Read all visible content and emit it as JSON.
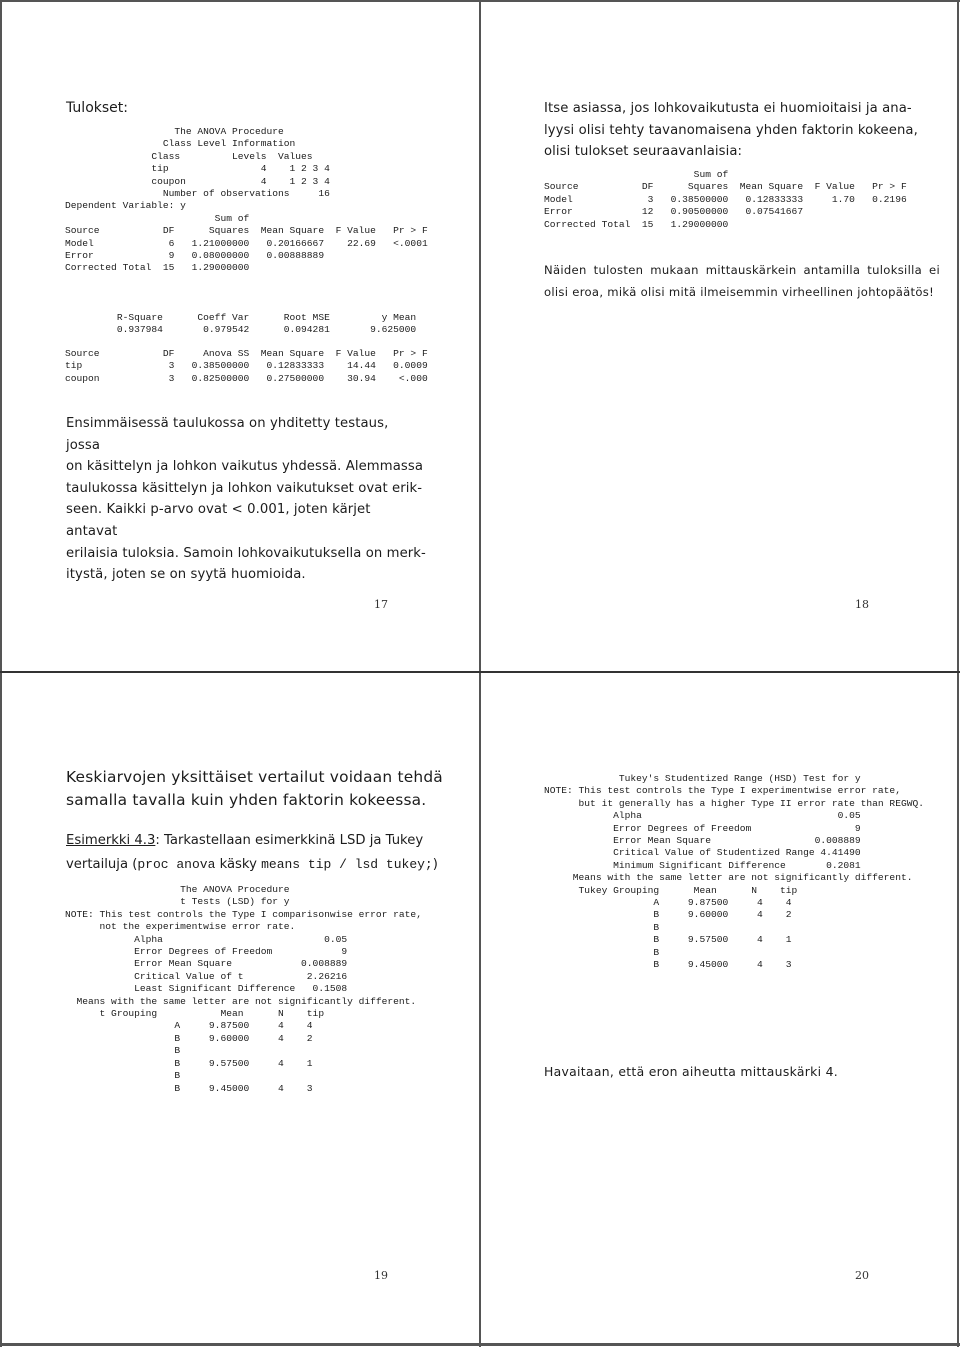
{
  "pages": [
    {
      "number": "17",
      "heading": "Tulokset:",
      "anova_title": "The ANOVA Procedure",
      "class_info": {
        "title": "Class Level Information",
        "headers": [
          "Class",
          "Levels",
          "Values"
        ],
        "rows": [
          [
            "tip",
            "4",
            "1 2 3 4"
          ],
          [
            "coupon",
            "4",
            "1 2 3 4"
          ]
        ],
        "observations_label": "Number of observations",
        "observations_value": "16"
      },
      "dependent_variable": "Dependent Variable: y",
      "model_table": {
        "headers": [
          "Source",
          "DF",
          "Sum of Squares",
          "Mean Square",
          "F Value",
          "Pr > F"
        ],
        "rows": [
          [
            "Model",
            "6",
            "1.21000000",
            "0.20166667",
            "22.69",
            "<.0001"
          ],
          [
            "Error",
            "9",
            "0.08000000",
            "0.00888889",
            "",
            ""
          ],
          [
            "Corrected Total",
            "15",
            "1.29000000",
            "",
            "",
            ""
          ]
        ]
      },
      "fit_stats": {
        "headers": [
          "R-Square",
          "Coeff Var",
          "Root MSE",
          "y Mean"
        ],
        "values": [
          "0.937984",
          "0.979542",
          "0.094281",
          "9.625000"
        ]
      },
      "effects_table": {
        "headers": [
          "Source",
          "DF",
          "Anova SS",
          "Mean Square",
          "F Value",
          "Pr > F"
        ],
        "rows": [
          [
            "tip",
            "3",
            "0.38500000",
            "0.12833333",
            "14.44",
            "0.0009"
          ],
          [
            "coupon",
            "3",
            "0.82500000",
            "0.27500000",
            "30.94",
            "<.000"
          ]
        ]
      },
      "paragraph": [
        "Ensimmäisessä taulukossa on yhditetty testaus, jossa",
        "on käsittelyn ja lohkon vaikutus yhdessä. Alemmassa",
        "taulukossa käsittelyn ja lohkon vaikutukset ovat erik-",
        "seen. Kaikki p-arvo ovat < 0.001, joten kärjet antavat",
        "erilaisia tuloksia. Samoin lohkovaikutuksella on merk-",
        "itystä, joten se on syytä huomioida."
      ]
    },
    {
      "number": "18",
      "paragraph": [
        "Itse asiassa, jos lohkovaikutusta ei huomioitaisi ja ana-",
        "lyysi olisi tehty tavanomaisena yhden faktorin kokeena,",
        "olisi tulokset seuraavanlaisia:"
      ],
      "oneway_table": {
        "headers": [
          "Source",
          "DF",
          "Sum of Squares",
          "Mean Square",
          "F Value",
          "Pr > F"
        ],
        "rows": [
          [
            "Model",
            "3",
            "0.38500000",
            "0.12833333",
            "1.70",
            "0.2196"
          ],
          [
            "Error",
            "12",
            "0.90500000",
            "0.07541667",
            "",
            ""
          ],
          [
            "Corrected Total",
            "15",
            "1.29000000",
            "",
            "",
            ""
          ]
        ]
      },
      "conclusion": [
        "Näiden tulosten mukaan mittauskärkein antamilla tuloksilla ei",
        "olisi eroa, mikä olisi mitä ilmeisemmin virheellinen johtopäätös!"
      ]
    },
    {
      "number": "19",
      "intro": [
        "Keskiarvojen yksittäiset vertailut voidaan tehdä",
        "samalla tavalla kuin yhden faktorin kokeessa."
      ],
      "example_label": "Esimerkki 4.3",
      "example_text_1": ":  Tarkastellaan esimerkkinä LSD ja Tukey",
      "example_text_2_pre": "vertailuja (",
      "example_code_1": "proc anova",
      "example_word": " käsky ",
      "example_code_2": "means tip / lsd tukey;",
      "example_text_2_post": ")",
      "lsd": {
        "title_1": "The ANOVA Procedure",
        "title_2": "t Tests (LSD) for y",
        "note_1": "NOTE: This test controls the Type I comparisonwise error rate,",
        "note_2": "not the experimentwise error rate.",
        "params": [
          [
            "Alpha",
            "0.05"
          ],
          [
            "Error Degrees of Freedom",
            "9"
          ],
          [
            "Error Mean Square",
            "0.008889"
          ],
          [
            "Critical Value of t",
            "2.26216"
          ],
          [
            "Least Significant Difference",
            "0.1508"
          ]
        ],
        "means_note": "Means with the same letter are not significantly different.",
        "grouping_headers": [
          "t Grouping",
          "Mean",
          "N",
          "tip"
        ],
        "grouping_rows": [
          [
            "A",
            "9.87500",
            "4",
            "4"
          ],
          [
            "",
            "",
            "",
            ""
          ],
          [
            "B",
            "9.60000",
            "4",
            "2"
          ],
          [
            "B",
            "",
            "",
            ""
          ],
          [
            "B",
            "9.57500",
            "4",
            "1"
          ],
          [
            "B",
            "",
            "",
            ""
          ],
          [
            "B",
            "9.45000",
            "4",
            "3"
          ]
        ]
      }
    },
    {
      "number": "20",
      "tukey": {
        "title": "Tukey's Studentized Range (HSD) Test for y",
        "note_1": "NOTE: This test controls the Type I experimentwise error rate,",
        "note_2": "but it generally has a higher Type II error rate than REGWQ.",
        "params": [
          [
            "Alpha",
            "0.05"
          ],
          [
            "Error Degrees of Freedom",
            "9"
          ],
          [
            "Error Mean Square",
            "0.008889"
          ],
          [
            "Critical Value of Studentized Range",
            "4.41490"
          ],
          [
            "Minimum Significant Difference",
            "0.2081"
          ]
        ],
        "means_note": "Means with the same letter are not significantly different.",
        "grouping_headers": [
          "Tukey Grouping",
          "Mean",
          "N",
          "tip"
        ],
        "grouping_rows": [
          [
            "A",
            "9.87500",
            "4",
            "4"
          ],
          [
            "",
            "",
            "",
            ""
          ],
          [
            "B",
            "9.60000",
            "4",
            "2"
          ],
          [
            "B",
            "",
            "",
            ""
          ],
          [
            "B",
            "9.57500",
            "4",
            "1"
          ],
          [
            "B",
            "",
            "",
            ""
          ],
          [
            "B",
            "9.45000",
            "4",
            "3"
          ]
        ]
      },
      "conclusion": "Havaitaan, että eron aiheutta mittauskärki 4."
    }
  ]
}
